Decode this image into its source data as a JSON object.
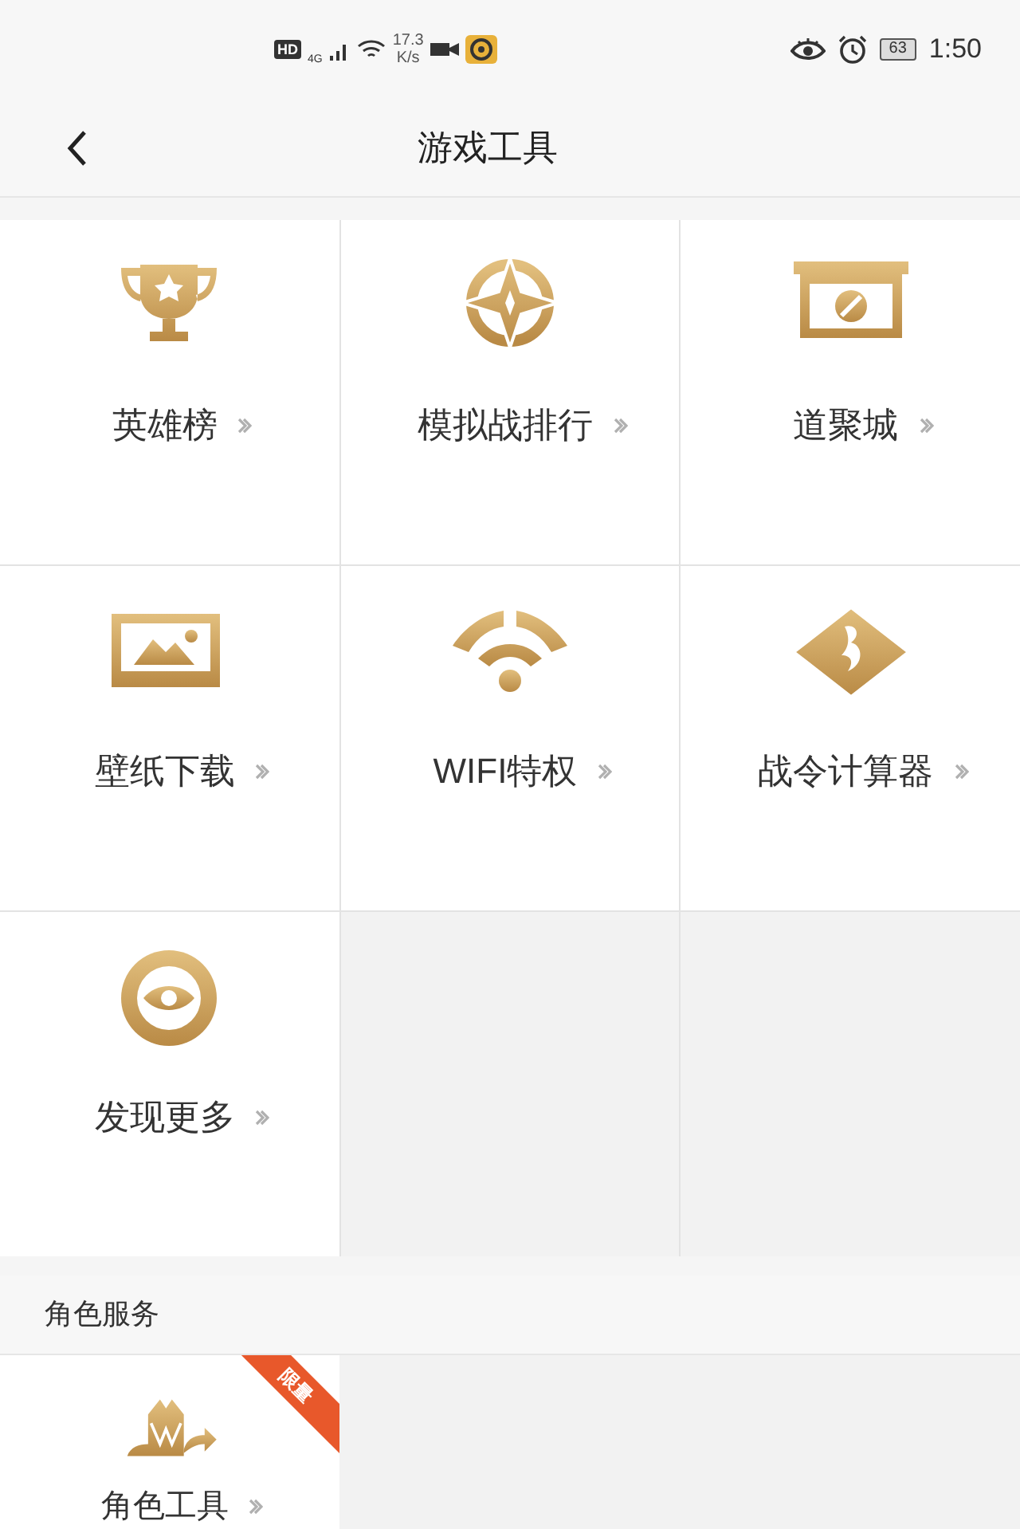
{
  "status_bar": {
    "left": [
      "HD",
      "4G"
    ],
    "speed": [
      "17.3",
      "K/s"
    ],
    "battery": "63",
    "time": "1:50"
  },
  "header": {
    "title": "游戏工具"
  },
  "tools": [
    {
      "label": "英雄榜",
      "kind": "trophy"
    },
    {
      "label": "模拟战排行",
      "kind": "star"
    },
    {
      "label": "道聚城",
      "kind": "shop"
    },
    {
      "label": "壁纸下载",
      "kind": "image"
    },
    {
      "label": "WIFI特权",
      "kind": "wifi"
    },
    {
      "label": "战令计算器",
      "kind": "diamond"
    },
    {
      "label": "发现更多",
      "kind": "eye"
    }
  ],
  "section": {
    "title": "角色服务",
    "items": [
      {
        "label": "角色工具",
        "badge": "限量",
        "kind": "role"
      }
    ]
  }
}
